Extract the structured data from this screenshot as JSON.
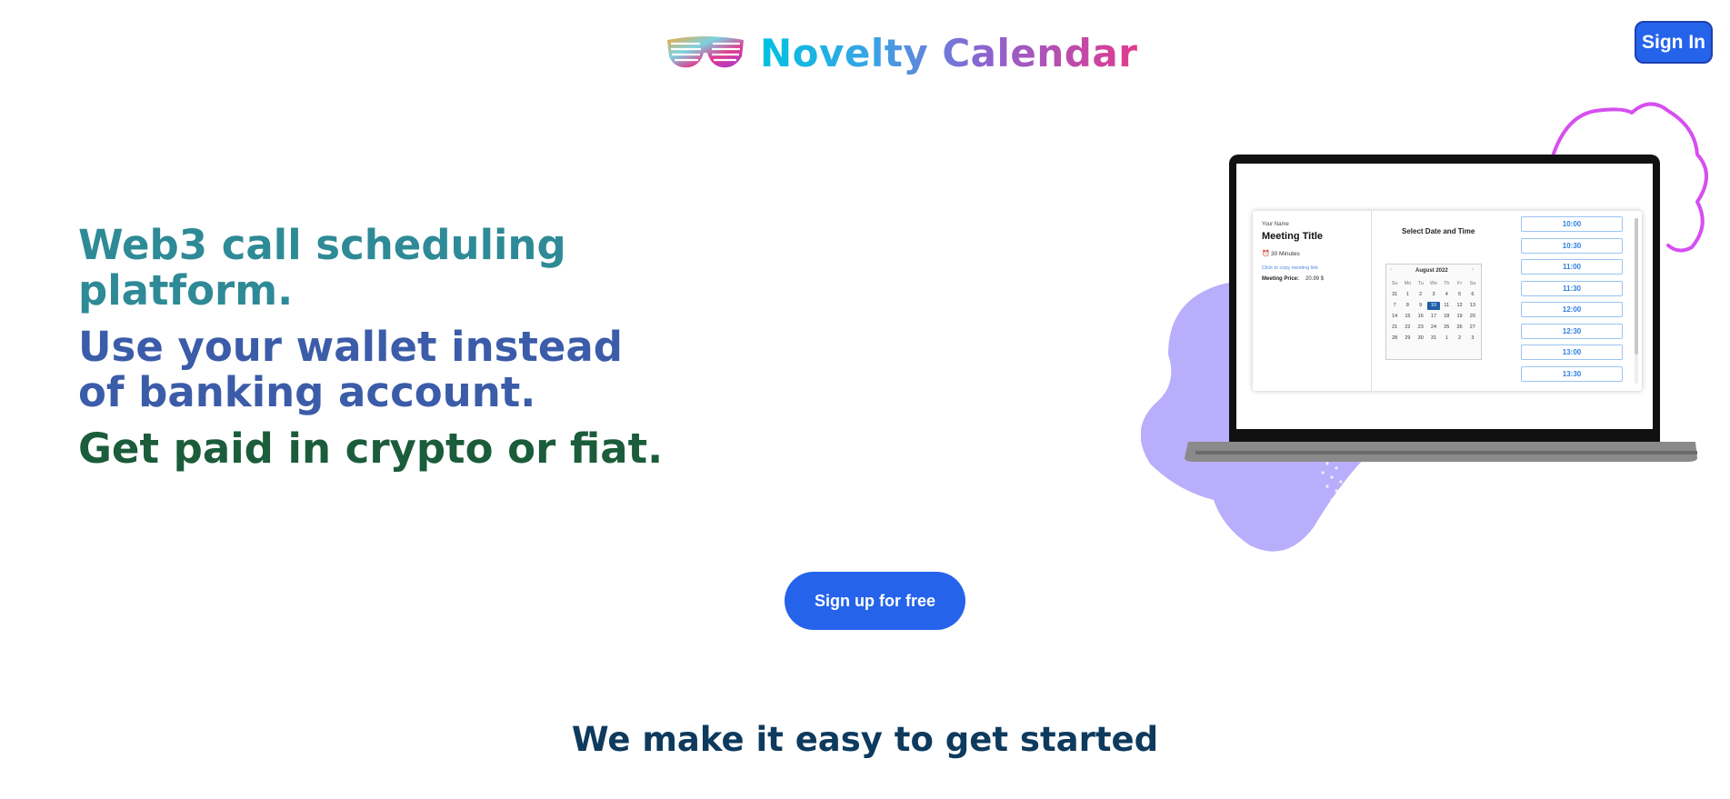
{
  "header": {
    "brand_name": "Novelty Calendar",
    "sign_in_label": "Sign In"
  },
  "hero": {
    "line1": "Web3 call scheduling platform.",
    "line2a": "Use your wallet instead",
    "line2b": "of banking account.",
    "line3": "Get paid in crypto or fiat."
  },
  "mockup": {
    "your_name_label": "Your Name",
    "meeting_title": "Meeting Title",
    "duration": "30 Minutes",
    "copy_link": "Click to copy meeting link",
    "price_label": "Meeting Price:",
    "price_value": "20.99 $",
    "select_heading": "Select Date and Time",
    "month": "August 2022",
    "weekdays": [
      "Su",
      "Mo",
      "Tu",
      "We",
      "Th",
      "Fr",
      "Sa"
    ],
    "days": [
      "31",
      "1",
      "2",
      "3",
      "4",
      "5",
      "6",
      "7",
      "8",
      "9",
      "10",
      "11",
      "12",
      "13",
      "14",
      "15",
      "16",
      "17",
      "18",
      "19",
      "20",
      "21",
      "22",
      "23",
      "24",
      "25",
      "26",
      "27",
      "28",
      "29",
      "30",
      "31",
      "1",
      "2",
      "3"
    ],
    "selected_day": "10",
    "time_slots": [
      "10:00",
      "10:30",
      "11:00",
      "11:30",
      "12:00",
      "12:30",
      "13:00",
      "13:30"
    ]
  },
  "cta": {
    "signup_label": "Sign up for free"
  },
  "section": {
    "title": "We make it easy to get started"
  },
  "colors": {
    "primary_button": "#2563eb",
    "hero_line1": "#2e8a96",
    "hero_line2": "#3b5ca8",
    "hero_line3": "#1b5c3b",
    "section_title": "#0e3a5e",
    "blob": "#b9aefb",
    "squiggle": "#d64ff0"
  },
  "icons": {
    "logo": "party-glasses-icon",
    "clock": "alarm-clock-icon"
  }
}
